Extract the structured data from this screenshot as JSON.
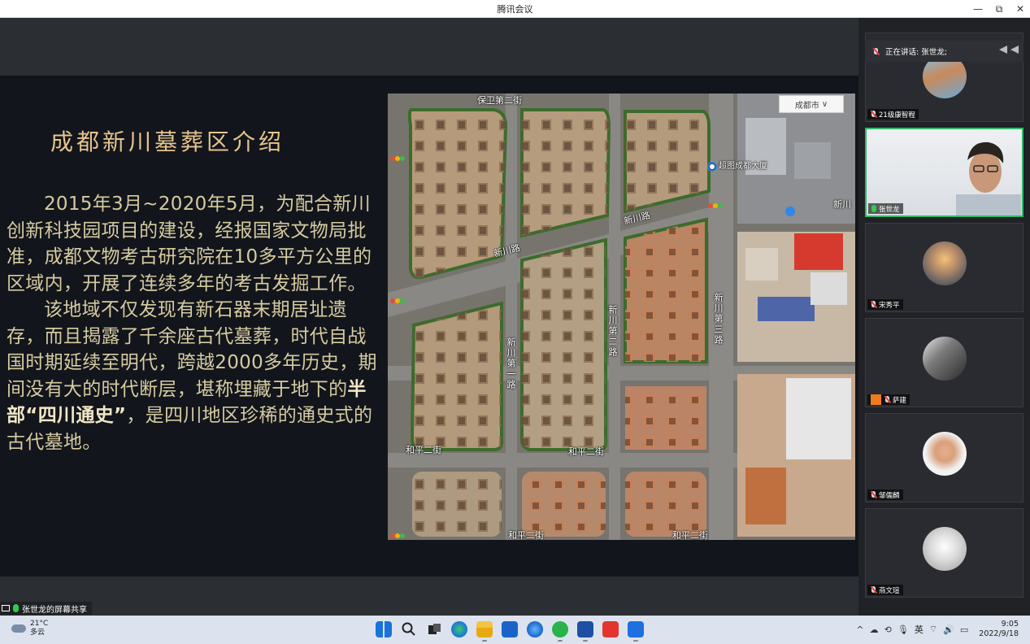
{
  "window": {
    "title": "腾讯会议",
    "minimize": "—",
    "restore": "⧉",
    "close": "✕"
  },
  "slide": {
    "title": "成都新川墓葬区介绍",
    "paragraph1": "2015年3月~2020年5月，为配合新川创新科技园项目的建设，经报国家文物局批准，成都文物考古研究院在10多平方公里的区域内，开展了连续多年的考古发掘工作。",
    "paragraph2_before": "该地域不仅发现有新石器末期居址遗存，而且揭露了千余座古代墓葬，时代自战国时期延续至明代，跨越2000多年历史，期间没有大的时代断层，堪称埋藏于地下的",
    "paragraph2_highlight": "半部“四川通史”",
    "paragraph2_after": "，是四川地区珍稀的通史式的古代墓地。"
  },
  "map": {
    "city_selector": "成都市",
    "city_chevron": "∨",
    "poi": "超图成都大厦",
    "roads": {
      "top_left": "保卫第二街",
      "xinchuan_road_1": "新川路",
      "xinchuan_road_2": "新川路",
      "xin_road_a": "新川第一路",
      "xin_road_b": "新川第二路",
      "xin_road_c": "新川第三路",
      "heping_1": "和平二街",
      "heping_2": "和平二街",
      "heping_3": "和平二街",
      "heping_4": "和平二街",
      "right_label": "新川"
    }
  },
  "screen_share_label": "张世龙的屏幕共享",
  "panel": {
    "speaking": "正在讲话: 张世龙;",
    "participants": [
      {
        "name": "21级康智程",
        "mic": "off",
        "host": false
      },
      {
        "name": "张世龙",
        "mic": "on",
        "host": false,
        "active": true
      },
      {
        "name": "宋秀平",
        "mic": "off",
        "host": false
      },
      {
        "name": "萨建",
        "mic": "off",
        "host": true
      },
      {
        "name": "邹儒麟",
        "mic": "off",
        "host": false
      },
      {
        "name": "燕文瑄",
        "mic": "off",
        "host": false
      }
    ]
  },
  "taskbar": {
    "weather_temp": "21°C",
    "weather_desc": "多云",
    "ime": "英",
    "time": "9:05",
    "date": "2022/9/18",
    "tray_chevron": "^"
  },
  "colors": {
    "slide_bg": "#13151c",
    "title_gold": "#e6c58d",
    "text_beige": "#d5cba0",
    "active_green": "#2fb86a"
  }
}
